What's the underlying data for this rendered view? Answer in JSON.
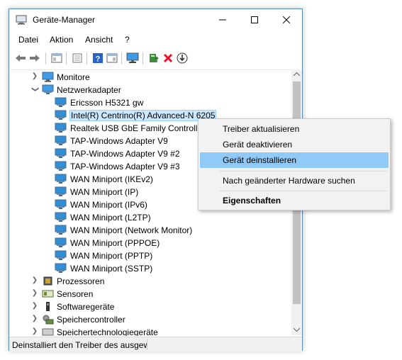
{
  "window": {
    "title": "Geräte-Manager"
  },
  "menubar": {
    "items": [
      "Datei",
      "Aktion",
      "Ansicht",
      "?"
    ]
  },
  "toolbar": {
    "icons": [
      "back-arrow-icon",
      "forward-arrow-icon",
      "properties-icon",
      "console-icon",
      "help-icon",
      "view-icon",
      "monitor-icon",
      "update-driver-icon",
      "uninstall-icon",
      "download-icon"
    ]
  },
  "tree": {
    "monitore": "Monitore",
    "netzwerkadapter": "Netzwerkadapter",
    "devices": [
      "Ericsson H5321 gw",
      "Intel(R) Centrino(R) Advanced-N 6205",
      "Realtek USB GbE Family Controller",
      "TAP-Windows Adapter V9",
      "TAP-Windows Adapter V9 #2",
      "TAP-Windows Adapter V9 #3",
      "WAN Miniport (IKEv2)",
      "WAN Miniport (IP)",
      "WAN Miniport (IPv6)",
      "WAN Miniport (L2TP)",
      "WAN Miniport (Network Monitor)",
      "WAN Miniport (PPPOE)",
      "WAN Miniport (PPTP)",
      "WAN Miniport (SSTP)"
    ],
    "categories": [
      "Prozessoren",
      "Sensoren",
      "Softwaregeräte",
      "Speichercontroller",
      "Speichertechnologiegeräte"
    ]
  },
  "context_menu": {
    "update": "Treiber aktualisieren",
    "disable": "Gerät deaktivieren",
    "uninstall": "Gerät deinstallieren",
    "scan": "Nach geänderter Hardware suchen",
    "properties": "Eigenschaften"
  },
  "status": {
    "text": "Deinstalliert den Treiber des ausgewählten Geräts."
  },
  "colors": {
    "accent": "#91c9f7",
    "selection": "#cce8ff",
    "net_icon": "#2f8fd8",
    "uninstall_red": "#e81123"
  }
}
